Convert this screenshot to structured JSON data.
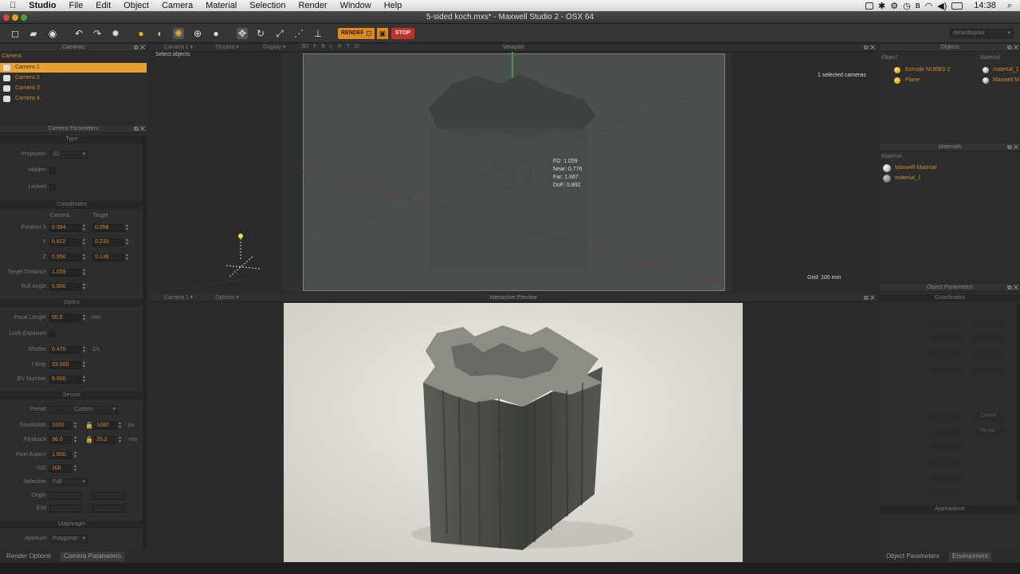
{
  "menubar": {
    "apple": "",
    "items": [
      "Studio",
      "File",
      "Edit",
      "Object",
      "Camera",
      "Material",
      "Selection",
      "Render",
      "Window",
      "Help"
    ],
    "clock": "14:38"
  },
  "window": {
    "title": "5-sided koch.mxs* - Maxwell Studio 2 - OSX 64"
  },
  "toolbar": {
    "render_label": "RENDER",
    "stop_label": "STOP",
    "layout_select": "defaultlayout"
  },
  "cameras_panel": {
    "title": "Cameras",
    "column": "Camera",
    "items": [
      "Camera 1",
      "Camera 2",
      "Camera 3",
      "Camera 4"
    ],
    "selected_index": 0
  },
  "camera_params": {
    "title": "Camera Parameters",
    "type_section": "Type",
    "projection_label": "Projection",
    "projection_value": "3D",
    "hidden_label": "Hidden",
    "locked_label": "Locked",
    "coords_section": "Coordinates",
    "col_camera": "Camera",
    "col_target": "Target",
    "pos_x_label": "Position X",
    "y_label": "Y",
    "z_label": "Z",
    "cam_x": "0.394",
    "cam_y": "0.822",
    "cam_z": "0.950",
    "tgt_x": "0.058",
    "tgt_y": "0.233",
    "tgt_z": "0.136",
    "target_distance_label": "Target Distance",
    "target_distance": "1.059",
    "roll_angle_label": "Roll Angle",
    "roll_angle": "0.000",
    "optics_section": "Optics",
    "focal_length_label": "Focal Length",
    "focal_length": "50.0",
    "focal_unit": "mm",
    "lock_exposure_label": "Lock Exposure",
    "shutter_label": "Shutter",
    "shutter": "0.470",
    "shutter_unit": "1/s",
    "fstop_label": "f-Stop",
    "fstop": "33.000",
    "ev_label": "EV Number",
    "ev": "9.000",
    "sensor_section": "Sensor",
    "preset_label": "Preset",
    "preset_value": "Custom",
    "resolution_label": "Resolution",
    "res_w": "1920",
    "res_h": "1080",
    "res_unit": "px",
    "filmback_label": "Filmback",
    "film_w": "36.0",
    "film_h": "20.2",
    "film_unit": "mm",
    "pixel_aspect_label": "Pixel Aspect",
    "pixel_aspect": "1.000",
    "iso_label": "ISO",
    "iso": "100",
    "selection_label": "Selection",
    "selection_value": "Full",
    "origin_label": "Origin",
    "end_label": "End",
    "diaphragm_section": "Diaphragm",
    "aperture_label": "Aperture",
    "aperture_value": "Polygonal"
  },
  "viewport": {
    "title": "Viewport",
    "camera_menu": "Camera 1",
    "shading_menu": "Shaded",
    "display_menu": "Display",
    "view_buttons": [
      "3D",
      "F",
      "B",
      "L",
      "R",
      "T",
      "D"
    ],
    "select_hint": "Select objects",
    "selected_info": "1 selected cameras",
    "grid_info": "Grid: 100 mm",
    "overlay": {
      "fd": "FD: 1.059",
      "near": "Near: 0.776",
      "far": "Far: 1.667",
      "dof": "DoF: 0.892"
    }
  },
  "preview": {
    "title": "Interactive Preview",
    "camera_menu": "Camera 1",
    "options_menu": "Options"
  },
  "objects_panel": {
    "title": "Objects",
    "col_object": "Object",
    "col_material": "Material",
    "items": [
      {
        "name": "Extrude NURBS 2",
        "material": "material_1"
      },
      {
        "name": "Plane",
        "material": "Maxwell M"
      }
    ]
  },
  "materials_panel": {
    "title": "Materials",
    "column": "Material",
    "items": [
      "Maxwell Material",
      "material_1"
    ]
  },
  "object_params": {
    "title": "Object Parameters",
    "coords_section": "Coordinates",
    "appearance_section": "Appearance",
    "center_button": "Centre",
    "reset_button": "Reset"
  },
  "bottom_tabs": {
    "left": [
      "Render Options",
      "Camera Parameters"
    ],
    "right": [
      "Object Parameters",
      "Environment"
    ]
  },
  "colors": {
    "accent": "#e8a030",
    "field_text": "#d0882a",
    "stop": "#c0312a"
  }
}
